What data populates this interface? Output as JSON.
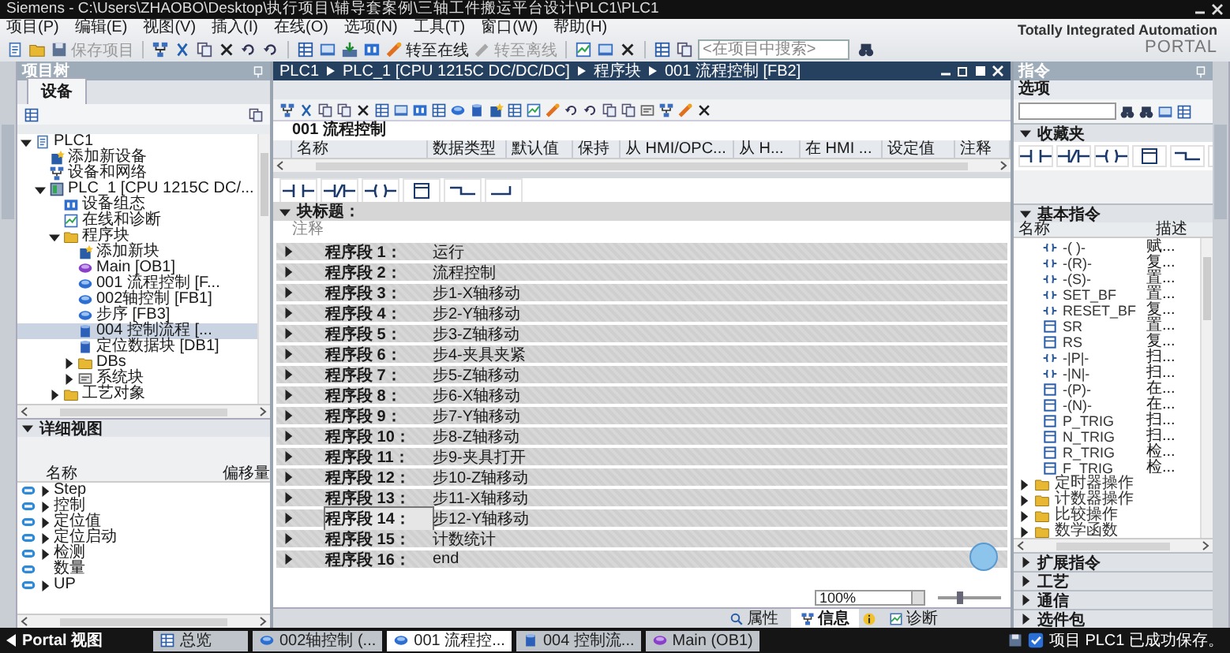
{
  "window": {
    "title": "Siemens - C:\\Users\\ZHAOBO\\Desktop\\执行项目\\辅导套案例\\三轴工件搬运平台设计\\PLC1\\PLC1"
  },
  "menu": [
    "项目(P)",
    "编辑(E)",
    "视图(V)",
    "插入(I)",
    "在线(O)",
    "选项(N)",
    "工具(T)",
    "窗口(W)",
    "帮助(H)"
  ],
  "brand": {
    "line1": "Totally Integrated Automation",
    "line2": "PORTAL"
  },
  "toolbar": {
    "buttons": [
      {
        "kind": "save",
        "label": "保存项目",
        "disabled": true
      },
      {
        "kind": "online",
        "label": "转至在线",
        "disabled": false
      },
      {
        "kind": "offline",
        "label": "转至离线",
        "disabled": true
      }
    ],
    "search_placeholder": "<在项目中搜索>"
  },
  "project_tree": {
    "title": "项目树",
    "tabs": [
      {
        "label": "设备",
        "selected": true
      }
    ],
    "items": [
      {
        "label": "PLC1",
        "kind": "project",
        "expanded": true,
        "selected": false,
        "children": [
          {
            "label": "添加新设备",
            "kind": "add",
            "selected": false
          },
          {
            "label": "设备和网络",
            "kind": "network",
            "selected": false
          },
          {
            "label": "PLC_1 [CPU 1215C DC/...",
            "kind": "cpu",
            "expanded": true,
            "selected": false,
            "children": [
              {
                "label": "设备组态",
                "kind": "config",
                "selected": false
              },
              {
                "label": "在线和诊断",
                "kind": "diagnostics",
                "selected": false
              },
              {
                "label": "程序块",
                "kind": "folder",
                "expanded": true,
                "selected": false,
                "children": [
                  {
                    "label": "添加新块",
                    "kind": "add",
                    "selected": false
                  },
                  {
                    "label": "Main [OB1]",
                    "kind": "ob",
                    "selected": false
                  },
                  {
                    "label": "001 流程控制 [F...",
                    "kind": "fb",
                    "selected": false
                  },
                  {
                    "label": "002轴控制 [FB1]",
                    "kind": "fb",
                    "selected": false
                  },
                  {
                    "label": "步序 [FB3]",
                    "kind": "fb",
                    "selected": false
                  },
                  {
                    "label": "004 控制流程 [...",
                    "kind": "db",
                    "selected": true
                  },
                  {
                    "label": "定位数据块 [DB1]",
                    "kind": "db",
                    "selected": false
                  },
                  {
                    "label": "DBs",
                    "kind": "folder",
                    "expanded": false,
                    "selected": false
                  },
                  {
                    "label": "系统块",
                    "kind": "system",
                    "expanded": false,
                    "selected": false
                  }
                ]
              },
              {
                "label": "工艺对象",
                "kind": "folder",
                "expanded": false,
                "selected": false
              }
            ]
          }
        ]
      }
    ]
  },
  "details": {
    "title": "详细视图",
    "columns": [
      "名称",
      "偏移量"
    ],
    "items": [
      {
        "label": "Step",
        "expanded": false
      },
      {
        "label": "控制",
        "expanded": false
      },
      {
        "label": "定位值",
        "expanded": false
      },
      {
        "label": "定位启动",
        "expanded": false
      },
      {
        "label": "检测",
        "expanded": false
      },
      {
        "label": "数量"
      },
      {
        "label": "UP",
        "expanded": false
      }
    ]
  },
  "editor": {
    "breadcrumb": [
      "PLC1",
      "PLC_1 [CPU 1215C DC/DC/DC]",
      "程序块",
      "001 流程控制 [FB2]"
    ],
    "block_name": "001 流程控制",
    "interface_columns": [
      "名称",
      "数据类型",
      "默认值",
      "保持",
      "从 HMI/OPC...",
      "从 H...",
      "在 HMI ...",
      "设定值",
      "注释"
    ],
    "block_title": {
      "label": "块标题：",
      "expanded": true,
      "comment": "注释"
    },
    "networks": [
      {
        "label": "程序段 1：",
        "title": "运行",
        "expanded": false,
        "selected": false
      },
      {
        "label": "程序段 2：",
        "title": "流程控制",
        "expanded": false,
        "selected": false
      },
      {
        "label": "程序段 3：",
        "title": "步1-X轴移动",
        "expanded": false,
        "selected": false
      },
      {
        "label": "程序段 4：",
        "title": "步2-Y轴移动",
        "expanded": false,
        "selected": false
      },
      {
        "label": "程序段 5：",
        "title": "步3-Z轴移动",
        "expanded": false,
        "selected": false
      },
      {
        "label": "程序段 6：",
        "title": "步4-夹具夹紧",
        "expanded": false,
        "selected": false
      },
      {
        "label": "程序段 7：",
        "title": "步5-Z轴移动",
        "expanded": false,
        "selected": false
      },
      {
        "label": "程序段 8：",
        "title": "步6-X轴移动",
        "expanded": false,
        "selected": false
      },
      {
        "label": "程序段 9：",
        "title": "步7-Y轴移动",
        "expanded": false,
        "selected": false
      },
      {
        "label": "程序段 10：",
        "title": "步8-Z轴移动",
        "expanded": false,
        "selected": false
      },
      {
        "label": "程序段 11：",
        "title": "步9-夹具打开",
        "expanded": false,
        "selected": false
      },
      {
        "label": "程序段 12：",
        "title": "步10-Z轴移动",
        "expanded": false,
        "selected": false
      },
      {
        "label": "程序段 13：",
        "title": "步11-X轴移动",
        "expanded": false,
        "selected": false
      },
      {
        "label": "程序段 14：",
        "title": "步12-Y轴移动",
        "expanded": false,
        "selected": true
      },
      {
        "label": "程序段 15：",
        "title": "计数统计",
        "expanded": false,
        "selected": false
      },
      {
        "label": "程序段 16：",
        "title": "end",
        "expanded": false,
        "selected": false
      }
    ],
    "zoom": "100%",
    "zoom_slider": {
      "level": 0.35
    },
    "inspector_tabs": [
      {
        "kind": "properties",
        "label": "属性",
        "selected": false
      },
      {
        "kind": "info",
        "label": "信息",
        "selected": true
      },
      {
        "kind": "diagnostics",
        "label": "诊断",
        "selected": false
      }
    ]
  },
  "instructions": {
    "title": "指令",
    "options_label": "选项",
    "favorites": {
      "label": "收藏夹",
      "expanded": true
    },
    "basic": {
      "label": "基本指令",
      "expanded": true,
      "columns": [
        "名称",
        "描述"
      ],
      "items": [
        {
          "name": "-( )-",
          "desc": "赋...",
          "kind": "coil"
        },
        {
          "name": "-(R)-",
          "desc": "复...",
          "kind": "coil"
        },
        {
          "name": "-(S)-",
          "desc": "置...",
          "kind": "coil"
        },
        {
          "name": "SET_BF",
          "desc": "置...",
          "kind": "coil"
        },
        {
          "name": "RESET_BF",
          "desc": "复...",
          "kind": "coil"
        },
        {
          "name": "SR",
          "desc": "置...",
          "kind": "box"
        },
        {
          "name": "RS",
          "desc": "复...",
          "kind": "box"
        },
        {
          "name": "-|P|-",
          "desc": "扫...",
          "kind": "coil"
        },
        {
          "name": "-|N|-",
          "desc": "扫...",
          "kind": "coil"
        },
        {
          "name": "-(P)-",
          "desc": "在...",
          "kind": "box"
        },
        {
          "name": "-(N)-",
          "desc": "在...",
          "kind": "box"
        },
        {
          "name": "P_TRIG",
          "desc": "扫...",
          "kind": "box"
        },
        {
          "name": "N_TRIG",
          "desc": "扫...",
          "kind": "box"
        },
        {
          "name": "R_TRIG",
          "desc": "检...",
          "kind": "box"
        },
        {
          "name": "F_TRIG",
          "desc": "检...",
          "kind": "box"
        },
        {
          "name": "定时器操作",
          "kind": "folder",
          "expanded": false
        },
        {
          "name": "计数器操作",
          "kind": "folder",
          "expanded": false
        },
        {
          "name": "比较操作",
          "kind": "folder",
          "expanded": false
        },
        {
          "name": "数学函数",
          "kind": "folder",
          "expanded": false
        }
      ]
    },
    "sections": [
      {
        "label": "扩展指令",
        "expanded": false
      },
      {
        "label": "工艺",
        "expanded": false
      },
      {
        "label": "通信",
        "expanded": false
      },
      {
        "label": "选件包",
        "expanded": false
      }
    ]
  },
  "taskbar": {
    "portal_label": "Portal 视图",
    "tabs": [
      {
        "kind": "overview",
        "label": "总览",
        "selected": false
      },
      {
        "kind": "fb",
        "label": "002轴控制 (...",
        "selected": false
      },
      {
        "kind": "fb",
        "label": "001 流程控...",
        "selected": true
      },
      {
        "kind": "db",
        "label": "004 控制流...",
        "selected": false
      },
      {
        "kind": "ob",
        "label": "Main (OB1)",
        "selected": false
      }
    ],
    "status": "项目 PLC1 已成功保存。"
  }
}
